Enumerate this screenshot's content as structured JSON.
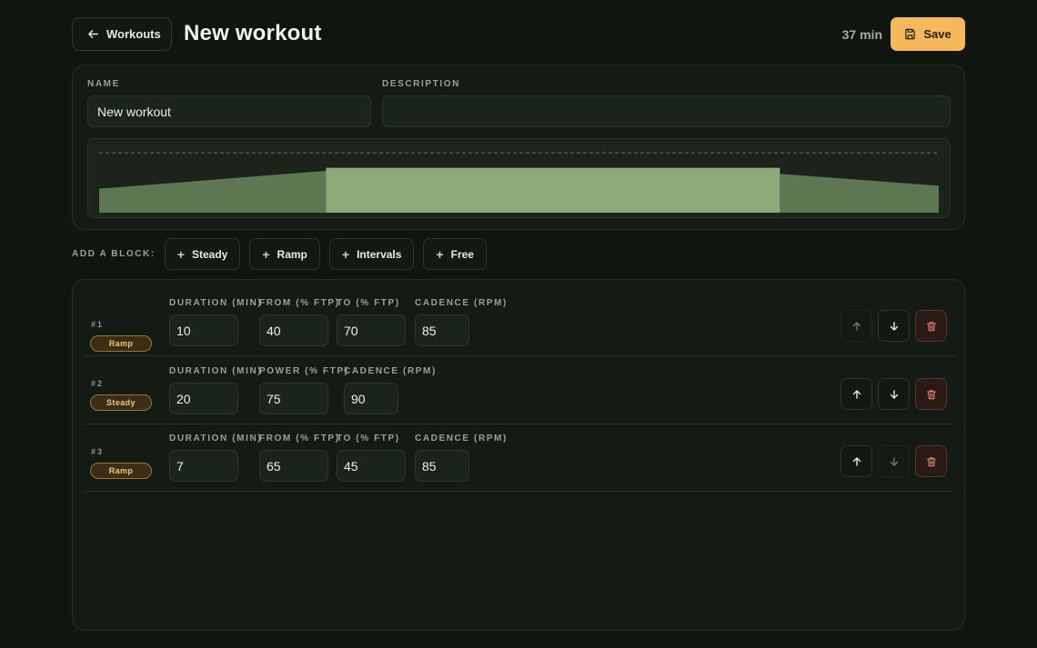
{
  "header": {
    "back_label": "Workouts",
    "title": "New workout",
    "total": "37 min",
    "save_label": "Save"
  },
  "form": {
    "name_label": "NAME",
    "name_value": "New workout",
    "description_label": "DESCRIPTION",
    "description_value": "",
    "description_placeholder": ""
  },
  "preview": {
    "ftp_line": 100,
    "max_pct": 120,
    "blocks": [
      {
        "type": "Ramp",
        "duration": 10,
        "from": 40,
        "to": 70
      },
      {
        "type": "Steady",
        "duration": 20,
        "power": 75
      },
      {
        "type": "Ramp",
        "duration": 7,
        "from": 65,
        "to": 45
      }
    ]
  },
  "add_block": {
    "label": "ADD A BLOCK:",
    "buttons": [
      "Steady",
      "Ramp",
      "Intervals",
      "Free"
    ]
  },
  "blocks": [
    {
      "num": "#1",
      "type": "Ramp",
      "fields": [
        {
          "label": "DURATION (MIN)",
          "value": "10"
        },
        {
          "label": "FROM (% FTP)",
          "value": "40"
        },
        {
          "label": "TO (% FTP)",
          "value": "70"
        },
        {
          "label": "CADENCE (RPM)",
          "value": "85"
        }
      ]
    },
    {
      "num": "#2",
      "type": "Steady",
      "fields": [
        {
          "label": "DURATION (MIN)",
          "value": "20"
        },
        {
          "label": "POWER (% FTP)",
          "value": "75"
        },
        {
          "label": "CADENCE (RPM)",
          "value": "90"
        }
      ]
    },
    {
      "num": "#3",
      "type": "Ramp",
      "fields": [
        {
          "label": "DURATION (MIN)",
          "value": "7"
        },
        {
          "label": "FROM (% FTP)",
          "value": "65"
        },
        {
          "label": "TO (% FTP)",
          "value": "45"
        },
        {
          "label": "CADENCE (RPM)",
          "value": "85"
        }
      ]
    }
  ],
  "colors": {
    "accent": "#f5b85c",
    "chart_ramp": "#5c7752",
    "chart_steady": "#8daa78",
    "badge_border": "#9a7435",
    "delete_border": "#5a3329"
  }
}
